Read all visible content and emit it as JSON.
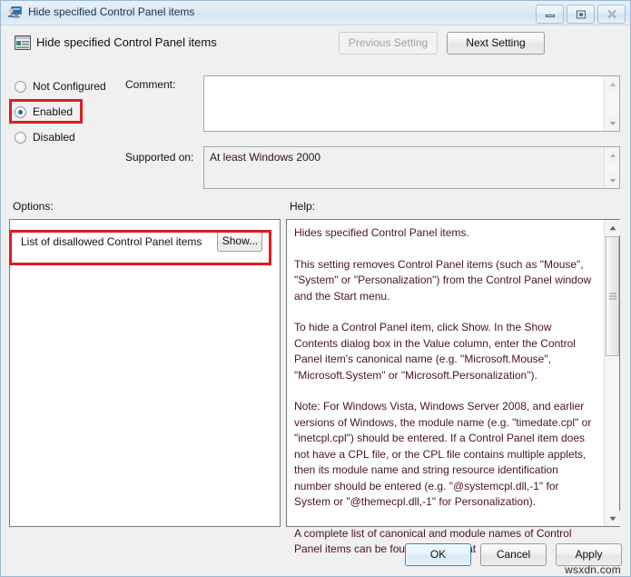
{
  "window": {
    "title": "Hide specified Control Panel items",
    "title_icon": "policy-monitor-icon",
    "controls": {
      "minimize": "minimize-icon",
      "maximize": "maximize-icon",
      "close": "close-icon"
    }
  },
  "header": {
    "icon": "setting-window-icon",
    "title": "Hide specified Control Panel items",
    "previous_setting": "Previous Setting",
    "next_setting": "Next Setting"
  },
  "state": {
    "options": [
      {
        "label": "Not Configured",
        "selected": false
      },
      {
        "label": "Enabled",
        "selected": true
      },
      {
        "label": "Disabled",
        "selected": false
      }
    ],
    "highlighted_option": "Enabled"
  },
  "comment": {
    "label": "Comment:",
    "value": ""
  },
  "supported_on": {
    "label": "Supported on:",
    "value": "At least Windows 2000"
  },
  "options_section": {
    "label": "Options:",
    "item_label": "List of disallowed Control Panel items",
    "show_button": "Show...",
    "highlighted": true
  },
  "help_section": {
    "label": "Help:",
    "paragraphs": [
      "Hides specified Control Panel items.",
      "This setting removes Control Panel items (such as \"Mouse\", \"System\" or \"Personalization\") from the Control Panel window and the Start menu.",
      "To hide a Control Panel item, click Show. In the Show Contents dialog box in the Value column, enter the Control Panel item's canonical name (e.g. \"Microsoft.Mouse\", \"Microsoft.System\" or \"Microsoft.Personalization\").",
      "Note: For Windows Vista, Windows Server 2008, and earlier versions of Windows, the module name (e.g. \"timedate.cpl\" or \"inetcpl.cpl\") should be entered. If a Control Panel item does not have a CPL file, or the CPL file contains multiple applets, then its module name and string resource identification number should be entered (e.g. \"@systemcpl.dll,-1\" for System or \"@themecpl.dll,-1\" for Personalization).",
      "A complete list of canonical and module names of Control Panel items can be found in MSDN at"
    ]
  },
  "footer": {
    "ok": "OK",
    "cancel": "Cancel",
    "apply": "Apply",
    "watermark": "wsxdn.com"
  },
  "colors": {
    "highlight": "#e01b22",
    "help_text": "#4b1030",
    "title_text": "#14344f",
    "radio_dot": "#1e6ba8"
  }
}
